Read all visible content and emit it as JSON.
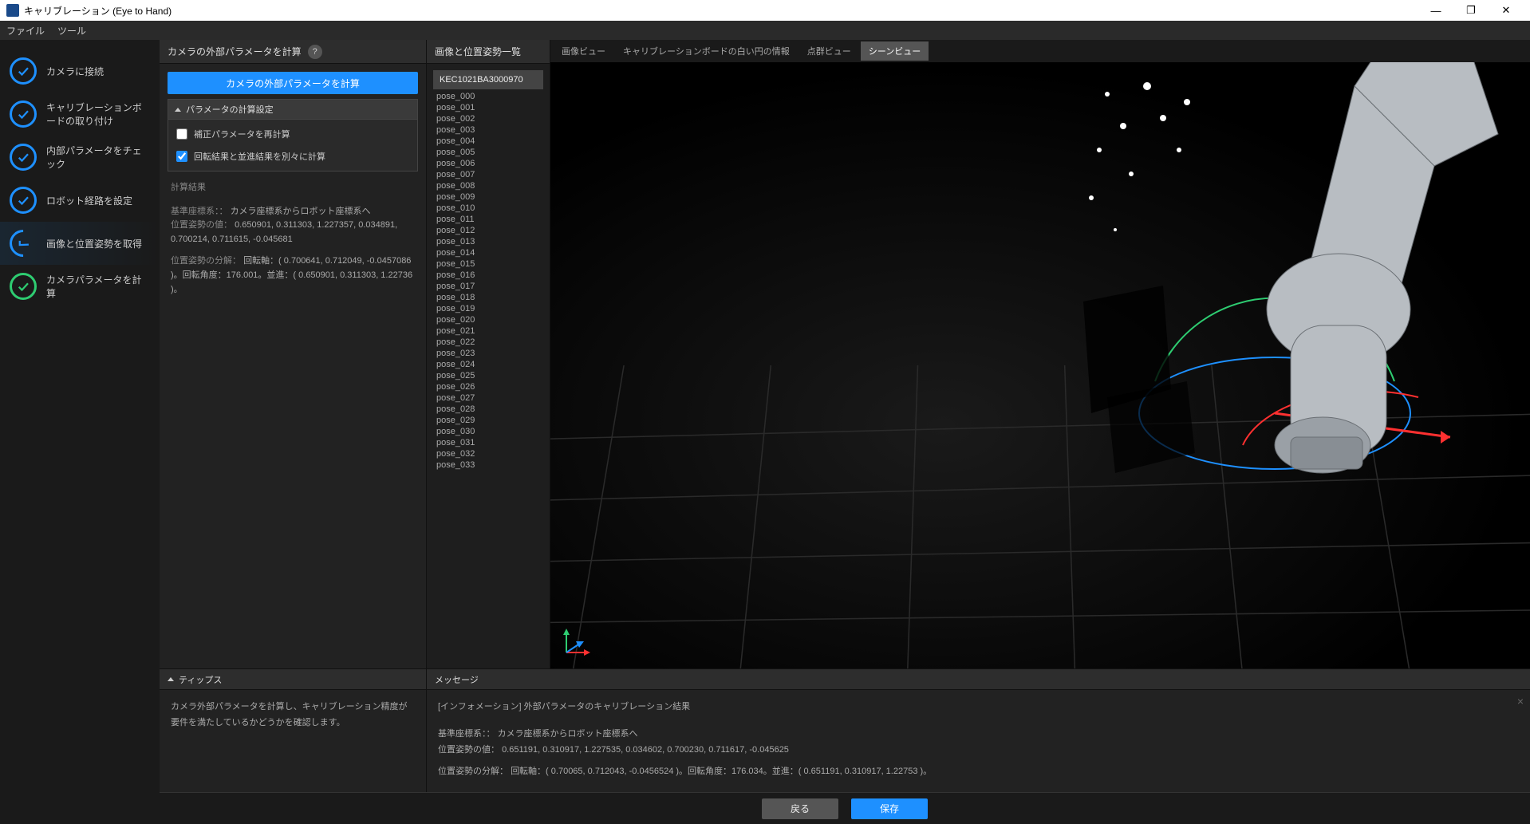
{
  "title": "キャリブレーション (Eye to Hand)",
  "menu": {
    "file": "ファイル",
    "tools": "ツール"
  },
  "steps": [
    {
      "label": "カメラに接続",
      "state": "check"
    },
    {
      "label": "キャリブレーションボードの取り付け",
      "state": "check"
    },
    {
      "label": "内部パラメータをチェック",
      "state": "check"
    },
    {
      "label": "ロボット経路を設定",
      "state": "check"
    },
    {
      "label": "画像と位置姿勢を取得",
      "state": "partial"
    },
    {
      "label": "カメラパラメータを計算",
      "state": "done"
    }
  ],
  "param": {
    "head": "カメラの外部パラメータを計算",
    "compute_button": "カメラの外部パラメータを計算",
    "collapse_label": "パラメータの計算設定",
    "chk_recalc": "補正パラメータを再計算",
    "chk_separate": "回転結果と並進結果を別々に計算"
  },
  "results": {
    "head": "計算結果",
    "base_label": "基準座標系：：",
    "base_val": "カメラ座標系からロボット座標系へ",
    "pose_label": "位置姿勢の値：",
    "pose_val": "0.650901, 0.311303, 1.227357, 0.034891, 0.700214, 0.711615, -0.045681",
    "decomp_label": "位置姿勢の分解：",
    "decomp_val": "回転軸：( 0.700641, 0.712049, -0.0457086 )。回転角度：176.001。並進：( 0.650901, 0.311303, 1.22736 )。"
  },
  "poselist": {
    "head": "画像と位置姿勢一覧",
    "group": "KEC1021BA3000970",
    "items": [
      "pose_000",
      "pose_001",
      "pose_002",
      "pose_003",
      "pose_004",
      "pose_005",
      "pose_006",
      "pose_007",
      "pose_008",
      "pose_009",
      "pose_010",
      "pose_011",
      "pose_012",
      "pose_013",
      "pose_014",
      "pose_015",
      "pose_016",
      "pose_017",
      "pose_018",
      "pose_019",
      "pose_020",
      "pose_021",
      "pose_022",
      "pose_023",
      "pose_024",
      "pose_025",
      "pose_026",
      "pose_027",
      "pose_028",
      "pose_029",
      "pose_030",
      "pose_031",
      "pose_032",
      "pose_033"
    ]
  },
  "viewtabs": {
    "image": "画像ビュー",
    "circle": "キャリブレーションボードの白い円の情報",
    "cloud": "点群ビュー",
    "scene": "シーンビュー"
  },
  "tips": {
    "head": "ティップス",
    "body": "カメラ外部パラメータを計算し、キャリブレーション精度が要件を満たしているかどうかを確認します。"
  },
  "msgs": {
    "head": "メッセージ",
    "info": "[インフォメーション] 外部パラメータのキャリブレーション結果",
    "base_label": "基準座標系：：",
    "base_val": "カメラ座標系からロボット座標系へ",
    "pose_label": "位置姿勢の値：",
    "pose_val": "0.651191, 0.310917, 1.227535, 0.034602, 0.700230, 0.711617, -0.045625",
    "decomp_label": "位置姿勢の分解：",
    "decomp_val": "回転軸：( 0.70065, 0.712043, -0.0456524 )。回転角度：176.034。並進：( 0.651191, 0.310917, 1.22753 )。"
  },
  "footer": {
    "back": "戻る",
    "save": "保存"
  }
}
